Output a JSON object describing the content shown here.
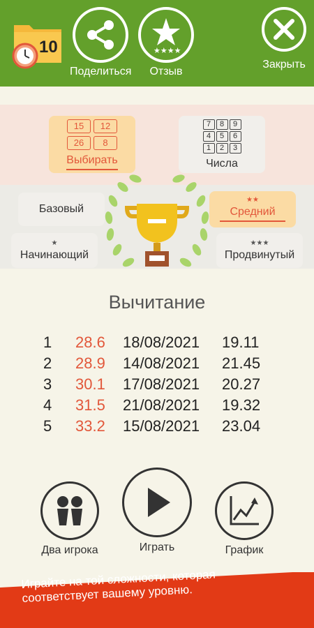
{
  "header": {
    "folder_count": "10",
    "share_label": "Поделиться",
    "review_label": "Отзыв",
    "close_label": "Закрыть"
  },
  "modes": {
    "choose": {
      "label": "Выбирать",
      "numbers": [
        "15",
        "12",
        "26",
        "8"
      ]
    },
    "numbers": {
      "label": "Числа",
      "keys": [
        "7",
        "8",
        "9",
        "4",
        "5",
        "6",
        "1",
        "2",
        "3"
      ]
    }
  },
  "levels": {
    "basic": "Базовый",
    "medium": "Средний",
    "medium_stars": "★★",
    "beginner": "Начинающий",
    "beginner_stars": "★",
    "advanced": "Продвинутый",
    "advanced_stars": "★★★"
  },
  "title": "Вычитание",
  "results": [
    {
      "rank": "1",
      "score": "28.6",
      "date": "18/08/2021",
      "time": "19.11"
    },
    {
      "rank": "2",
      "score": "28.9",
      "date": "14/08/2021",
      "time": "21.45"
    },
    {
      "rank": "3",
      "score": "30.1",
      "date": "17/08/2021",
      "time": "20.27"
    },
    {
      "rank": "4",
      "score": "31.5",
      "date": "21/08/2021",
      "time": "19.32"
    },
    {
      "rank": "5",
      "score": "33.2",
      "date": "15/08/2021",
      "time": "23.04"
    }
  ],
  "bottom": {
    "two_players": "Два игрока",
    "play": "Играть",
    "chart": "График"
  },
  "banner": "Играйте на той сложности, которая соответствует вашему уровню.",
  "colors": {
    "header": "#63a02b",
    "accent": "#e2573a",
    "selected": "#fbdba4"
  }
}
